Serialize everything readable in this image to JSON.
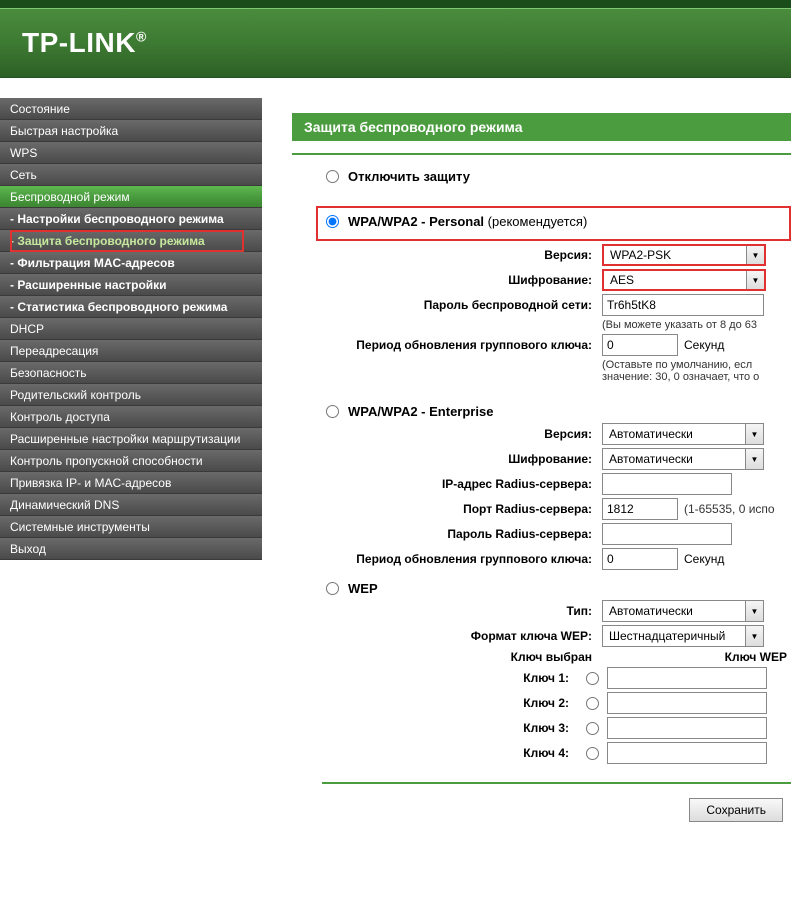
{
  "brand": "TP-LINK",
  "sidebar": {
    "items": [
      {
        "label": "Состояние",
        "type": "item"
      },
      {
        "label": "Быстрая настройка",
        "type": "item"
      },
      {
        "label": "WPS",
        "type": "item"
      },
      {
        "label": "Сеть",
        "type": "item"
      },
      {
        "label": "Беспроводной режим",
        "type": "item",
        "active": true
      },
      {
        "label": "- Настройки беспроводного режима",
        "type": "sub"
      },
      {
        "label": "- Защита беспроводного режима",
        "type": "sub",
        "current": true
      },
      {
        "label": "- Фильтрация MAC-адресов",
        "type": "sub"
      },
      {
        "label": "- Расширенные настройки",
        "type": "sub"
      },
      {
        "label": "- Статистика беспроводного режима",
        "type": "sub"
      },
      {
        "label": "DHCP",
        "type": "item"
      },
      {
        "label": "Переадресация",
        "type": "item"
      },
      {
        "label": "Безопасность",
        "type": "item"
      },
      {
        "label": "Родительский контроль",
        "type": "item"
      },
      {
        "label": "Контроль доступа",
        "type": "item"
      },
      {
        "label": "Расширенные настройки маршрутизации",
        "type": "item"
      },
      {
        "label": "Контроль пропускной способности",
        "type": "item"
      },
      {
        "label": "Привязка IP- и MAC-адресов",
        "type": "item"
      },
      {
        "label": "Динамический DNS",
        "type": "item"
      },
      {
        "label": "Системные инструменты",
        "type": "item"
      },
      {
        "label": "Выход",
        "type": "item"
      }
    ]
  },
  "page": {
    "title": "Защита беспроводного режима",
    "options": {
      "disable": "Отключить защиту",
      "wpa_personal": "WPA/WPA2 - Personal",
      "recommended": "(рекомендуется)",
      "wpa_enterprise": "WPA/WPA2 - Enterprise",
      "wep": "WEP"
    },
    "personal": {
      "version_label": "Версия:",
      "version_value": "WPA2-PSK",
      "cipher_label": "Шифрование:",
      "cipher_value": "AES",
      "password_label": "Пароль беспроводной сети:",
      "password_value": "Tr6h5tK8",
      "password_hint": "(Вы можете указать от 8 до 63",
      "gkup_label": "Период обновления группового ключа:",
      "gkup_value": "0",
      "gkup_unit": "Секунд",
      "gkup_hint": "(Оставьте по умолчанию, есл значение: 30, 0 означает, что о"
    },
    "enterprise": {
      "version_label": "Версия:",
      "version_value": "Автоматически",
      "cipher_label": "Шифрование:",
      "cipher_value": "Автоматически",
      "radius_ip_label": "IP-адрес Radius-сервера:",
      "radius_ip_value": "",
      "radius_port_label": "Порт Radius-сервера:",
      "radius_port_value": "1812",
      "radius_port_hint": "(1-65535, 0 испо",
      "radius_pass_label": "Пароль Radius-сервера:",
      "radius_pass_value": "",
      "gkup_label": "Период обновления группового ключа:",
      "gkup_value": "0",
      "gkup_unit": "Секунд"
    },
    "wep": {
      "type_label": "Тип:",
      "type_value": "Автоматически",
      "keyfmt_label": "Формат ключа WEP:",
      "keyfmt_value": "Шестнадцатеричный",
      "selected_label": "Ключ выбран",
      "header_key": "Ключ WEP",
      "key1_label": "Ключ 1:",
      "key2_label": "Ключ 2:",
      "key3_label": "Ключ 3:",
      "key4_label": "Ключ 4:"
    },
    "save": "Сохранить"
  }
}
